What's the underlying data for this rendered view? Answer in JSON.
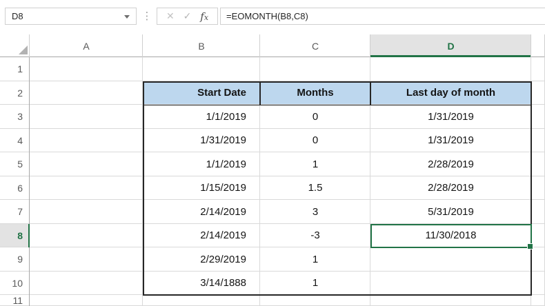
{
  "formula_bar": {
    "name_box_value": "D8",
    "formula": "=EOMONTH(B8,C8)",
    "cancel_label": "✕",
    "enter_label": "✓",
    "fx_f": "f",
    "fx_x": "x"
  },
  "sheet": {
    "col_letters": [
      "A",
      "B",
      "C",
      "D"
    ],
    "row_numbers": [
      "1",
      "2",
      "3",
      "4",
      "5",
      "6",
      "7",
      "8",
      "9",
      "10",
      "11"
    ],
    "table_headers": {
      "start_date": "Start Date",
      "months": "Months",
      "last_day": "Last day of month"
    },
    "cells": {
      "b3": "1/1/2019",
      "c3": "0",
      "d3": "1/31/2019",
      "b4": "1/31/2019",
      "c4": "0",
      "d4": "1/31/2019",
      "b5": "1/1/2019",
      "c5": "1",
      "d5": "2/28/2019",
      "b6": "1/15/2019",
      "c6": "1.5",
      "d6": "2/28/2019",
      "b7": "2/14/2019",
      "c7": "3",
      "d7": "5/31/2019",
      "b8": "2/14/2019",
      "c8": "-3",
      "d8": "11/30/2018",
      "b9": "2/29/2019",
      "c9": "1",
      "b10": "3/14/1888",
      "c10": "1"
    },
    "selection": {
      "active_cell": "D8",
      "selected_column": "D",
      "selected_row": "8"
    }
  },
  "colors": {
    "excel_green": "#217346",
    "table_header_fill": "#BDD7EE",
    "selected_header_fill": "#E3E3E3",
    "gridline": "#D9D9D9",
    "table_border": "#262626"
  }
}
